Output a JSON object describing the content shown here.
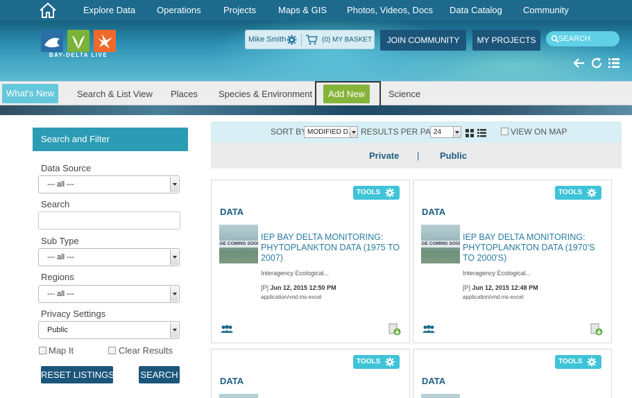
{
  "topnav": {
    "items": [
      "Explore Data",
      "Operations",
      "Projects",
      "Maps & GIS",
      "Photos, Videos, Docs",
      "Data Catalog",
      "Community"
    ]
  },
  "brand": {
    "caption": "BAY-DELTA LIVE"
  },
  "user": {
    "name": "Mike Smith",
    "basket": "(0) MY BASKET"
  },
  "header_buttons": {
    "join": "JOIN COMMUNITY",
    "projects": "MY PROJECTS"
  },
  "search": {
    "placeholder": "SEARCH"
  },
  "subnav": {
    "items": [
      "What's New",
      "Search & List View",
      "Places",
      "Species & Environment",
      "Add New",
      "Science"
    ]
  },
  "filters": {
    "title": "Search and Filter",
    "data_source": {
      "label": "Data Source",
      "value": "--- all ---"
    },
    "search": {
      "label": "Search",
      "value": ""
    },
    "sub_type": {
      "label": "Sub Type",
      "value": "--- all ---"
    },
    "regions": {
      "label": "Regions",
      "value": "--- all ---"
    },
    "privacy": {
      "label": "Privacy Settings",
      "value": "Public"
    },
    "map_it": "Map It",
    "clear_results": "Clear Results",
    "reset": "RESET LISTINGS",
    "search_button": "SEARCH"
  },
  "results": {
    "sort_label": "SORT BY",
    "sort_value": "MODIFIED D.",
    "per_page_label": "RESULTS PER PAGE",
    "per_page_value": "24",
    "view_on_map": "VIEW ON MAP",
    "tabs": {
      "private": "Private",
      "separator": "|",
      "public": "Public"
    }
  },
  "cards": [
    {
      "tools": "TOOLS",
      "type": "DATA",
      "thumb_text": "AGE COMING SOON",
      "title": "IEP BAY DELTA MONITORING: PHYTOPLANKTON DATA (1975 TO 2007)",
      "org": "Interagency Ecological...",
      "privacy": "[P]",
      "date": "Jun 12, 2015 12:50 PM",
      "mime": "application/vnd.ms-excel"
    },
    {
      "tools": "TOOLS",
      "type": "DATA",
      "thumb_text": "AGE COMING SOON",
      "title": "IEP BAY DELTA MONITORING: PHYTOPLANKTON DATA (1970'S TO 2000'S)",
      "org": "Interagency Ecological...",
      "privacy": "[P]",
      "date": "Jun 12, 2015 12:48 PM",
      "mime": "application/vnd.ms-excel"
    },
    {
      "tools": "TOOLS",
      "type": "DATA"
    },
    {
      "tools": "TOOLS",
      "type": "DATA"
    }
  ],
  "colors": {
    "nav_bg": "#1d6a8d",
    "accent_teal": "#2b9cb4",
    "tools_cyan": "#3fc3d8",
    "navy_button": "#1b557a",
    "add_new_green": "#86b43a",
    "link_blue": "#2a7ba3"
  }
}
